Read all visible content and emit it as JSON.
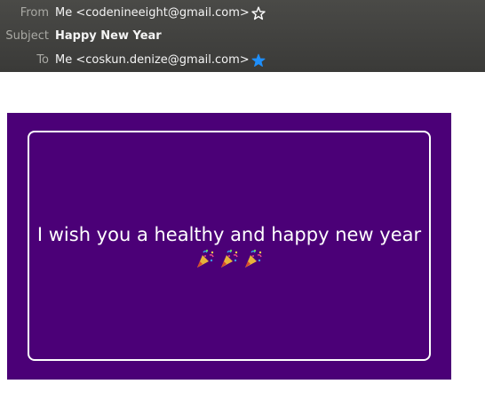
{
  "email": {
    "from_label": "From",
    "from_value": "Me <codenineeight@gmail.com>",
    "subject_label": "Subject",
    "subject_value": "Happy New Year",
    "to_label": "To",
    "to_value": "Me <coskun.denize@gmail.com>",
    "from_star_icon": "star-outline-icon",
    "to_star_icon": "star-filled-icon"
  },
  "body": {
    "message": "I wish you a healthy and happy new year",
    "emoji_icon": "party-popper-icon",
    "emoji_count": 3
  },
  "colors": {
    "header_bg": "#3f3f3d",
    "card_bg": "#4b0077",
    "star_filled": "#1f8ffb"
  }
}
